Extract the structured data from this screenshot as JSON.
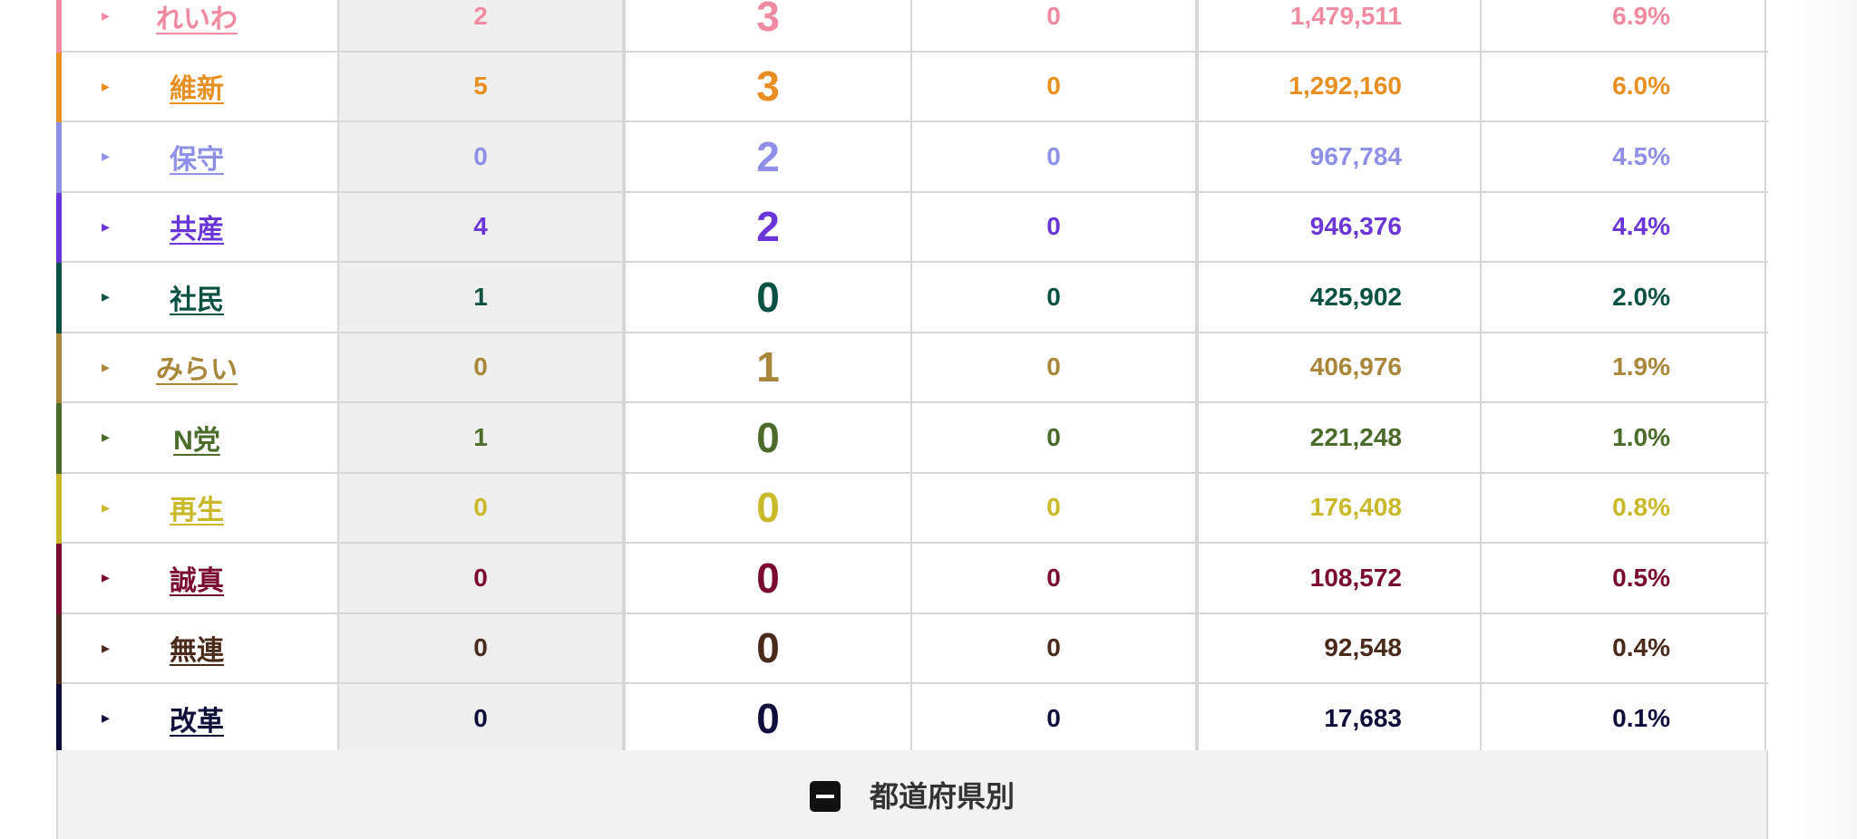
{
  "parties": [
    {
      "name": "れいわ",
      "prev": "2",
      "seats": "3",
      "extra": "0",
      "votes": "1,479,511",
      "pct": "6.9%",
      "color": "#f08aa0"
    },
    {
      "name": "維新",
      "prev": "5",
      "seats": "3",
      "extra": "0",
      "votes": "1,292,160",
      "pct": "6.0%",
      "color": "#e88f22"
    },
    {
      "name": "保守",
      "prev": "0",
      "seats": "2",
      "extra": "0",
      "votes": "967,784",
      "pct": "4.5%",
      "color": "#8f8fe8"
    },
    {
      "name": "共産",
      "prev": "4",
      "seats": "2",
      "extra": "0",
      "votes": "946,376",
      "pct": "4.4%",
      "color": "#6a36d9"
    },
    {
      "name": "社民",
      "prev": "1",
      "seats": "0",
      "extra": "0",
      "votes": "425,902",
      "pct": "2.0%",
      "color": "#0b5245"
    },
    {
      "name": "みらい",
      "prev": "0",
      "seats": "1",
      "extra": "0",
      "votes": "406,976",
      "pct": "1.9%",
      "color": "#a8863a"
    },
    {
      "name": "N党",
      "prev": "1",
      "seats": "0",
      "extra": "0",
      "votes": "221,248",
      "pct": "1.0%",
      "color": "#4a6b2a"
    },
    {
      "name": "再生",
      "prev": "0",
      "seats": "0",
      "extra": "0",
      "votes": "176,408",
      "pct": "0.8%",
      "color": "#c8b82a"
    },
    {
      "name": "誠真",
      "prev": "0",
      "seats": "0",
      "extra": "0",
      "votes": "108,572",
      "pct": "0.5%",
      "color": "#7a0a32"
    },
    {
      "name": "無連",
      "prev": "0",
      "seats": "0",
      "extra": "0",
      "votes": "92,548",
      "pct": "0.4%",
      "color": "#4a2a1a"
    },
    {
      "name": "改革",
      "prev": "0",
      "seats": "0",
      "extra": "0",
      "votes": "17,683",
      "pct": "0.1%",
      "color": "#0e0e3a"
    }
  ],
  "row_arrow": "▸",
  "footer": {
    "label": "都道府県別",
    "icon": "minus-square-icon"
  }
}
